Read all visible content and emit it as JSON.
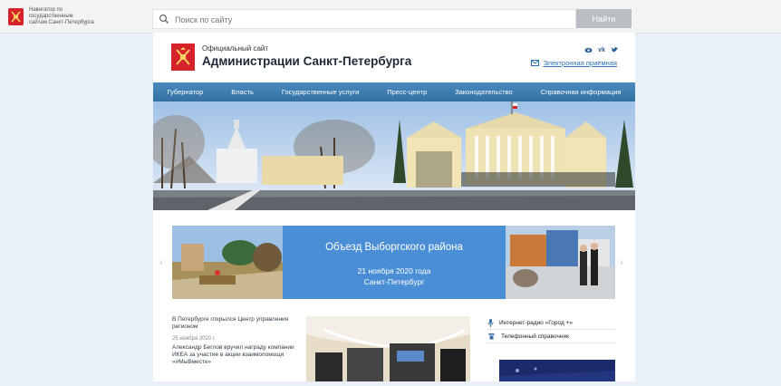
{
  "navigator": {
    "line1": "Навигатор по",
    "line2": "государственным",
    "line3": "сайтам Санкт-Петербурга"
  },
  "search": {
    "placeholder": "Поиск по сайту",
    "button": "Найти"
  },
  "site": {
    "subtitle": "Официальный сайт",
    "title": "Администрации Санкт-Петербурга",
    "reception": "Электронная приёмная"
  },
  "social": [
    "eye-icon",
    "vk-icon",
    "twitter-icon"
  ],
  "menu": [
    "Губернатор",
    "Власть",
    "Государственные услуги",
    "Пресс-центр",
    "Законодательство",
    "Справочная информация"
  ],
  "slide": {
    "title": "Объезд Выборгского района",
    "date": "21 ноября 2020 года",
    "place": "Санкт-Петербург"
  },
  "news": [
    {
      "title": "В Петербурге открылся Центр управления регионом",
      "date": "25 ноября 2020 г."
    },
    {
      "title": "Александр Беглов вручил награду компании ИКЕА за участие в акции взаимопомощи «#МыВместе»"
    }
  ],
  "side_links": [
    {
      "icon": "microphone-icon",
      "label": "Интернет-радио «Город +»"
    },
    {
      "icon": "phone-icon",
      "label": "Телефонный справочник"
    }
  ],
  "colors": {
    "menu_blue": "#3a7ab0",
    "slide_blue": "#4a8fd6",
    "emblem_red": "#d6232b",
    "search_button": "#b9bec3"
  }
}
